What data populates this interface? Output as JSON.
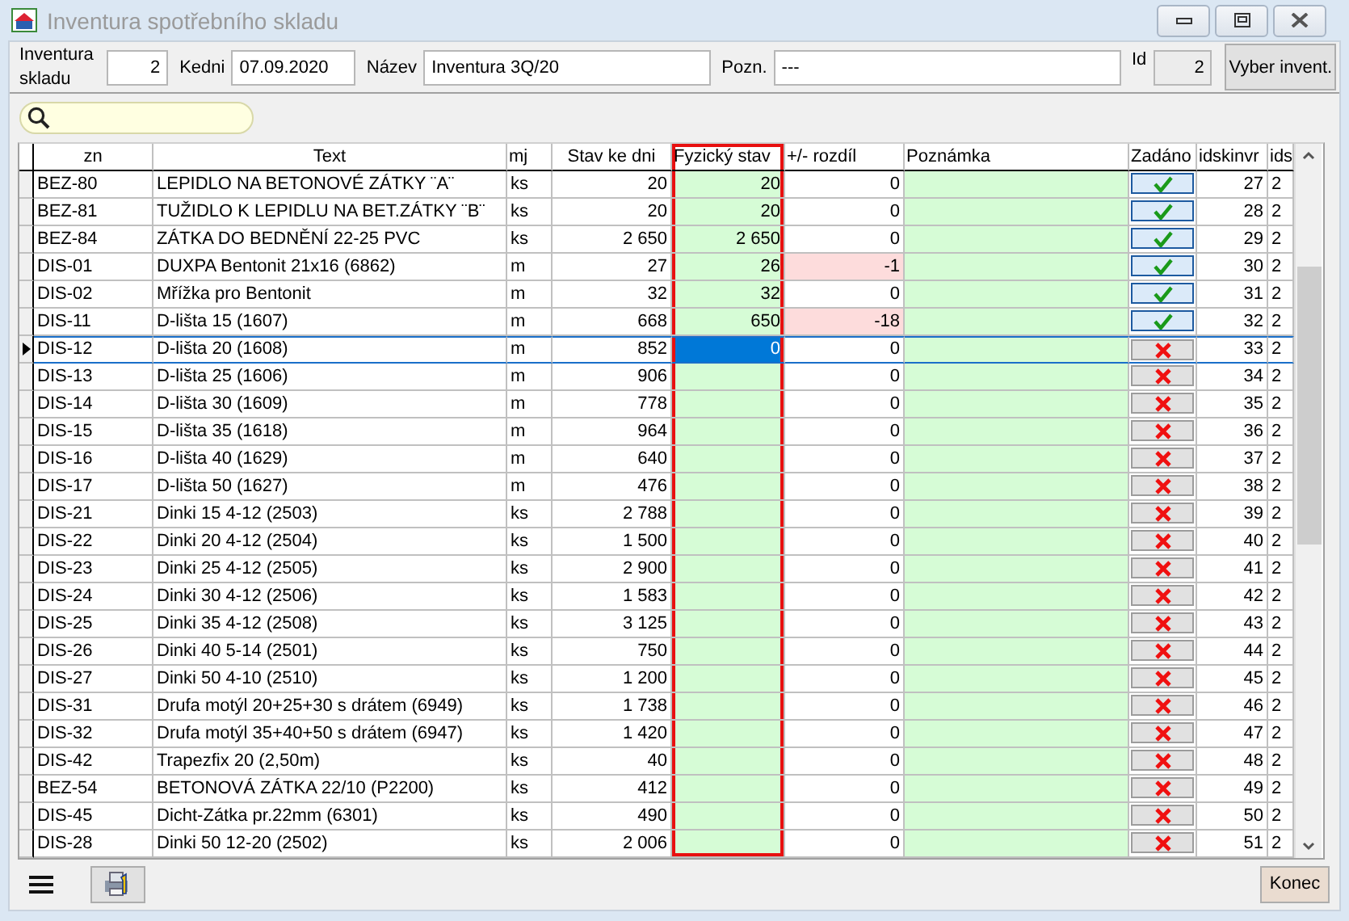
{
  "window": {
    "title": "Inventura spotřebního skladu"
  },
  "header": {
    "fields": [
      {
        "label": "Inventura skladu",
        "value": "2",
        "readonly": false
      },
      {
        "label": "Kedni",
        "value": "07.09.2020",
        "readonly": false
      },
      {
        "label": "Název",
        "value": "Inventura 3Q/20",
        "readonly": false
      },
      {
        "label": "Pozn.",
        "value": "---",
        "readonly": false
      },
      {
        "label": "Id",
        "value": "2",
        "readonly": true
      }
    ],
    "button": "Vyber invent."
  },
  "grid": {
    "columns": [
      {
        "title": "zn",
        "editable": false,
        "highlighted": false
      },
      {
        "title": "Text",
        "editable": false,
        "highlighted": false
      },
      {
        "title": "mj",
        "editable": false,
        "highlighted": false
      },
      {
        "title": "Stav ke dni",
        "editable": false,
        "highlighted": false
      },
      {
        "title": "Fyzický stav",
        "editable": true,
        "highlighted": true
      },
      {
        "title": "+/- rozdíl",
        "editable": false,
        "highlighted": false
      },
      {
        "title": "Poznámka",
        "editable": true,
        "highlighted": false
      },
      {
        "title": "Zadáno",
        "editable": false,
        "highlighted": false
      },
      {
        "title": "idskinvr",
        "editable": false,
        "highlighted": false
      },
      {
        "title": "ids",
        "editable": false,
        "highlighted": false
      }
    ],
    "rows": [
      {
        "zn": "BEZ-80",
        "text": "LEPIDLO NA BETONOVÉ ZÁTKY ¨A¨",
        "mj": "ks",
        "stav": "20",
        "fyzicky": "20",
        "rozdil": "0",
        "zadano": true,
        "idskinvr": "27",
        "ids": "2",
        "mismatch": false,
        "selected": false
      },
      {
        "zn": "BEZ-81",
        "text": "TUŽIDLO K LEPIDLU NA BET.ZÁTKY ¨B¨",
        "mj": "ks",
        "stav": "20",
        "fyzicky": "20",
        "rozdil": "0",
        "zadano": true,
        "idskinvr": "28",
        "ids": "2",
        "mismatch": false,
        "selected": false
      },
      {
        "zn": "BEZ-84",
        "text": "ZÁTKA DO BEDNĚNÍ 22-25 PVC",
        "mj": "ks",
        "stav": "2 650",
        "fyzicky": "2 650",
        "rozdil": "0",
        "zadano": true,
        "idskinvr": "29",
        "ids": "2",
        "mismatch": false,
        "selected": false
      },
      {
        "zn": "DIS-01",
        "text": "DUXPA Bentonit 21x16 (6862)",
        "mj": "m",
        "stav": "27",
        "fyzicky": "26",
        "rozdil": "-1",
        "zadano": true,
        "idskinvr": "30",
        "ids": "2",
        "mismatch": true,
        "selected": false
      },
      {
        "zn": "DIS-02",
        "text": "Mřížka pro Bentonit",
        "mj": "m",
        "stav": "32",
        "fyzicky": "32",
        "rozdil": "0",
        "zadano": true,
        "idskinvr": "31",
        "ids": "2",
        "mismatch": false,
        "selected": false
      },
      {
        "zn": "DIS-11",
        "text": "D-lišta 15 (1607)",
        "mj": "m",
        "stav": "668",
        "fyzicky": "650",
        "rozdil": "-18",
        "zadano": true,
        "idskinvr": "32",
        "ids": "2",
        "mismatch": true,
        "selected": false
      },
      {
        "zn": "DIS-12",
        "text": "D-lišta 20 (1608)",
        "mj": "m",
        "stav": "852",
        "fyzicky": "0",
        "rozdil": "0",
        "zadano": false,
        "idskinvr": "33",
        "ids": "2",
        "mismatch": false,
        "selected": true
      },
      {
        "zn": "DIS-13",
        "text": "D-lišta 25 (1606)",
        "mj": "m",
        "stav": "906",
        "rozdil": "0",
        "zadano": false,
        "idskinvr": "34",
        "ids": "2",
        "mismatch": false,
        "selected": false
      },
      {
        "zn": "DIS-14",
        "text": "D-lišta 30 (1609)",
        "mj": "m",
        "stav": "778",
        "rozdil": "0",
        "zadano": false,
        "idskinvr": "35",
        "ids": "2",
        "mismatch": false,
        "selected": false
      },
      {
        "zn": "DIS-15",
        "text": "D-lišta 35 (1618)",
        "mj": "m",
        "stav": "964",
        "rozdil": "0",
        "zadano": false,
        "idskinvr": "36",
        "ids": "2",
        "mismatch": false,
        "selected": false
      },
      {
        "zn": "DIS-16",
        "text": "D-lišta 40 (1629)",
        "mj": "m",
        "stav": "640",
        "rozdil": "0",
        "zadano": false,
        "idskinvr": "37",
        "ids": "2",
        "mismatch": false,
        "selected": false
      },
      {
        "zn": "DIS-17",
        "text": "D-lišta 50 (1627)",
        "mj": "m",
        "stav": "476",
        "rozdil": "0",
        "zadano": false,
        "idskinvr": "38",
        "ids": "2",
        "mismatch": false,
        "selected": false
      },
      {
        "zn": "DIS-21",
        "text": "Dinki 15 4-12 (2503)",
        "mj": "ks",
        "stav": "2 788",
        "rozdil": "0",
        "zadano": false,
        "idskinvr": "39",
        "ids": "2",
        "mismatch": false,
        "selected": false
      },
      {
        "zn": "DIS-22",
        "text": "Dinki 20 4-12 (2504)",
        "mj": "ks",
        "stav": "1 500",
        "rozdil": "0",
        "zadano": false,
        "idskinvr": "40",
        "ids": "2",
        "mismatch": false,
        "selected": false
      },
      {
        "zn": "DIS-23",
        "text": "Dinki 25 4-12 (2505)",
        "mj": "ks",
        "stav": "2 900",
        "rozdil": "0",
        "zadano": false,
        "idskinvr": "41",
        "ids": "2",
        "mismatch": false,
        "selected": false
      },
      {
        "zn": "DIS-24",
        "text": "Dinki 30 4-12 (2506)",
        "mj": "ks",
        "stav": "1 583",
        "rozdil": "0",
        "zadano": false,
        "idskinvr": "42",
        "ids": "2",
        "mismatch": false,
        "selected": false
      },
      {
        "zn": "DIS-25",
        "text": "Dinki 35 4-12 (2508)",
        "mj": "ks",
        "stav": "3 125",
        "rozdil": "0",
        "zadano": false,
        "idskinvr": "43",
        "ids": "2",
        "mismatch": false,
        "selected": false
      },
      {
        "zn": "DIS-26",
        "text": "Dinki 40 5-14 (2501)",
        "mj": "ks",
        "stav": "750",
        "rozdil": "0",
        "zadano": false,
        "idskinvr": "44",
        "ids": "2",
        "mismatch": false,
        "selected": false
      },
      {
        "zn": "DIS-27",
        "text": "Dinki 50 4-10 (2510)",
        "mj": "ks",
        "stav": "1 200",
        "rozdil": "0",
        "zadano": false,
        "idskinvr": "45",
        "ids": "2",
        "mismatch": false,
        "selected": false
      },
      {
        "zn": "DIS-31",
        "text": "Drufa motýl 20+25+30 s drátem (6949)",
        "mj": "ks",
        "stav": "1 738",
        "rozdil": "0",
        "zadano": false,
        "idskinvr": "46",
        "ids": "2",
        "mismatch": false,
        "selected": false
      },
      {
        "zn": "DIS-32",
        "text": "Drufa motýl 35+40+50 s drátem (6947)",
        "mj": "ks",
        "stav": "1 420",
        "rozdil": "0",
        "zadano": false,
        "idskinvr": "47",
        "ids": "2",
        "mismatch": false,
        "selected": false
      },
      {
        "zn": "DIS-42",
        "text": "Trapezfix 20 (2,50m)",
        "mj": "ks",
        "stav": "40",
        "rozdil": "0",
        "zadano": false,
        "idskinvr": "48",
        "ids": "2",
        "mismatch": false,
        "selected": false
      },
      {
        "zn": "BEZ-54",
        "text": "BETONOVÁ ZÁTKA 22/10 (P2200)",
        "mj": "ks",
        "stav": "412",
        "rozdil": "0",
        "zadano": false,
        "idskinvr": "49",
        "ids": "2",
        "mismatch": false,
        "selected": false
      },
      {
        "zn": "DIS-45",
        "text": "Dicht-Zátka pr.22mm (6301)",
        "mj": "ks",
        "stav": "490",
        "rozdil": "0",
        "zadano": false,
        "idskinvr": "50",
        "ids": "2",
        "mismatch": false,
        "selected": false
      },
      {
        "zn": "DIS-28",
        "text": "Dinki 50 12-20 (2502)",
        "mj": "ks",
        "stav": "2 006",
        "rozdil": "0",
        "zadano": false,
        "idskinvr": "51",
        "ids": "2",
        "mismatch": false,
        "selected": false
      }
    ]
  },
  "footer": {
    "button": "Konec"
  }
}
